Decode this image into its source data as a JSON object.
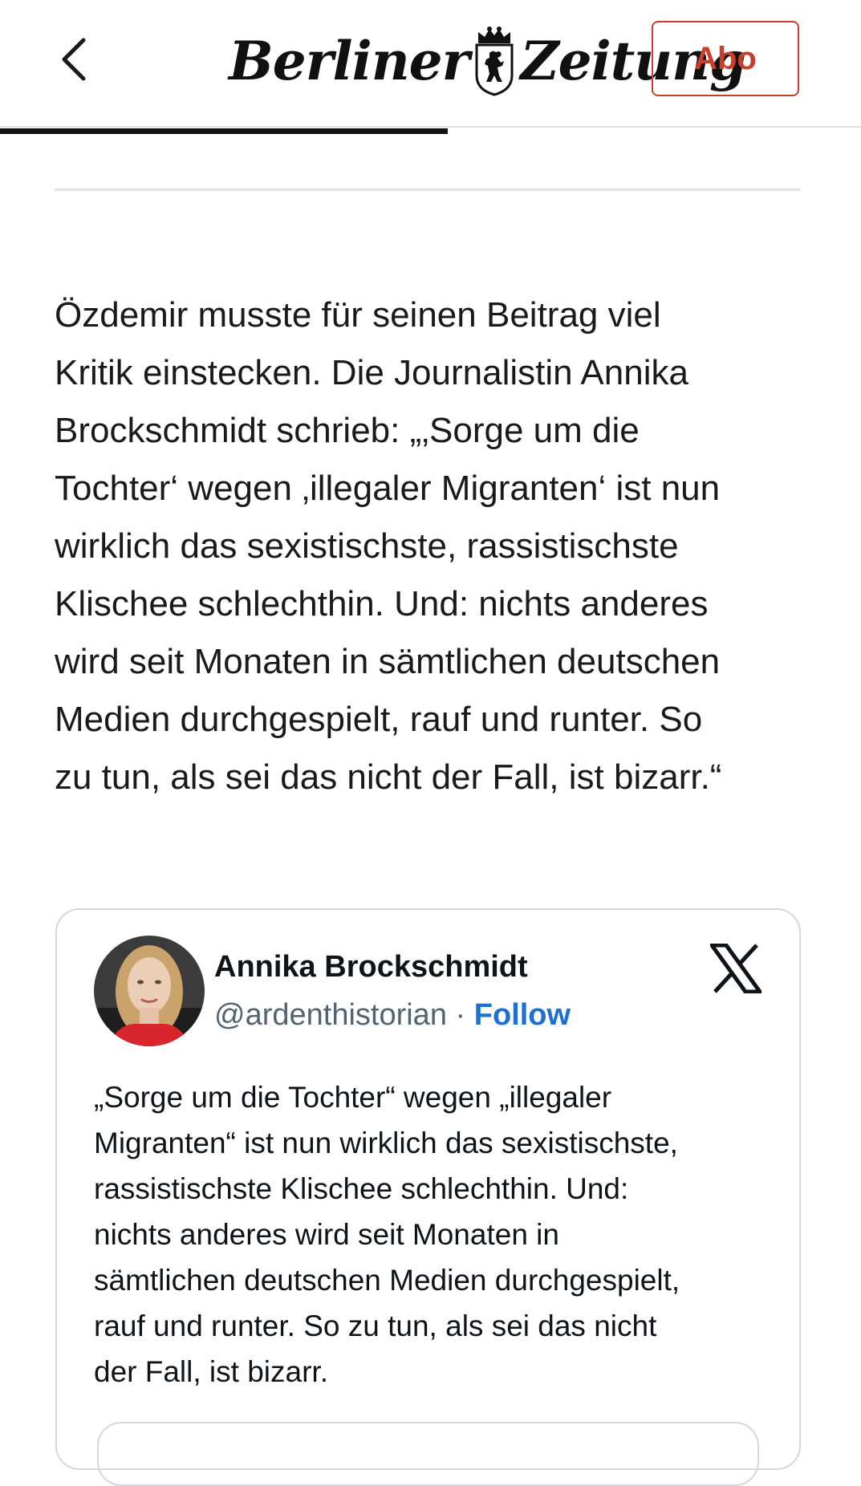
{
  "header": {
    "back_icon": "chevron-left-icon",
    "logo": {
      "word_left": "Berliner",
      "word_right": "Zeitung",
      "crest_icon": "berlin-bear-crest-icon"
    },
    "subscribe_label": "Abo",
    "accent_color": "#c8402b"
  },
  "reading_progress": 0.52,
  "article": {
    "paragraph": "Özdemir musste für seinen Beitrag viel\nKritik einstecken. Die Journalistin Annika\nBrockschmidt schrieb: „‚Sorge um die\nTochter‘ wegen ‚illegaler Migranten‘ ist nun\nwirklich das sexistischste, rassistischste\nKlischee schlechthin. Und: nichts anderes\nwird seit Monaten in sämtlichen deutschen\nMedien durchgespielt, rauf und runter. So\nzu tun, als sei das nicht der Fall, ist bizarr.“"
  },
  "tweet": {
    "author_name": "Annika Brockschmidt",
    "handle": "@ardenthistorian",
    "separator": " · ",
    "follow_label": "Follow",
    "platform_icon": "x-logo-icon",
    "avatar_icon": "profile-avatar",
    "link_color": "#1d6fd1",
    "text": "„Sorge um die Tochter“ wegen „illegaler\nMigranten“ ist nun wirklich das sexistischste,\nrassistischste Klischee schlechthin. Und:\nnichts anderes wird seit Monaten in\nsämtlichen deutschen Medien durchgespielt,\nrauf und runter. So zu tun, als sei das nicht\nder Fall, ist bizarr."
  }
}
